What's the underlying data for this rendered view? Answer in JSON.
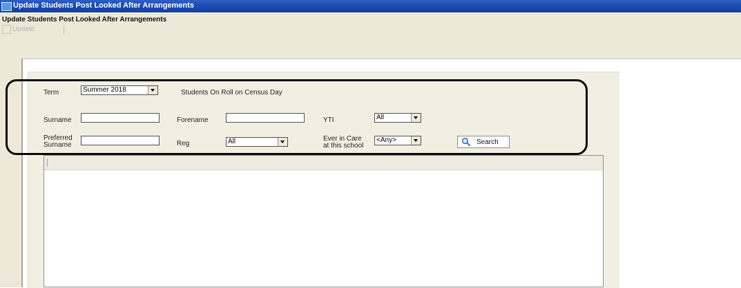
{
  "window": {
    "title": "Update Students Post Looked After Arrangements"
  },
  "header": {
    "title": "Update Students Post Looked After Arrangements",
    "toolbar": {
      "update_label": "Update"
    }
  },
  "filters": {
    "term": {
      "label": "Term",
      "value": "Summer 2018"
    },
    "census_note": "Students On Roll on Census Day",
    "surname": {
      "label": "Surname",
      "value": ""
    },
    "forename": {
      "label": "Forename",
      "value": ""
    },
    "yti": {
      "label": "YTI",
      "value": "All"
    },
    "preferred_surname": {
      "label_line1": "Preferred",
      "label_line2": "Surname",
      "value": ""
    },
    "reg": {
      "label": "Reg",
      "value": "All"
    },
    "ever_in_care": {
      "label_line1": "Ever in Care",
      "label_line2": "at this school",
      "value": "<Any>"
    },
    "search_label": "Search"
  },
  "icons": {
    "app": "window-app-icon",
    "update": "update-icon",
    "search": "magnifier-icon"
  },
  "colors": {
    "titlebar": "#1f4fb3",
    "panel": "#f1efe2",
    "highlight": "#0a0a0a"
  }
}
